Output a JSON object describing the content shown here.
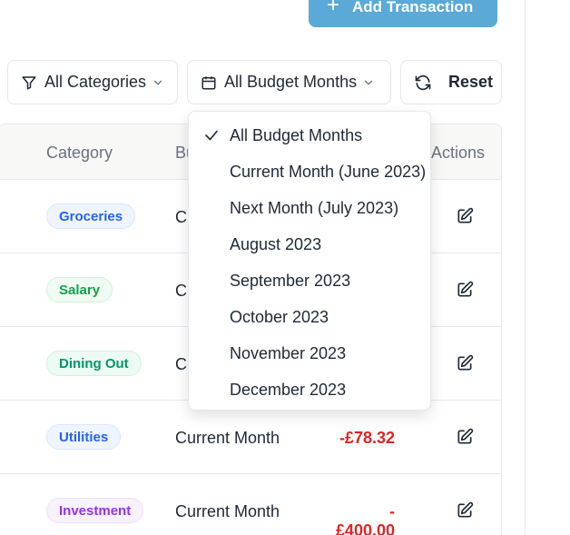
{
  "header": {
    "add_button_label": "Add Transaction",
    "add_icon": "+"
  },
  "filters": {
    "category": {
      "label": "All Categories",
      "icon": "filter-icon"
    },
    "budget_month": {
      "label": "All Budget Months",
      "icon": "calendar-icon"
    },
    "reset": {
      "label": "Reset",
      "icon": "refresh-icon"
    }
  },
  "table": {
    "columns": {
      "category": "Category",
      "budget": "Bu",
      "actions": "Actions"
    },
    "rows": [
      {
        "category": "Groceries",
        "budget": "Cu",
        "amount": ""
      },
      {
        "category": "Salary",
        "budget": "Cu",
        "amount": ""
      },
      {
        "category": "Dining Out",
        "budget": "Cu",
        "amount": ""
      },
      {
        "category": "Utilities",
        "budget": "Current Month",
        "amount": "-£78.32"
      },
      {
        "category": "Investment",
        "budget": "Current Month",
        "amount": "-£400.00"
      }
    ]
  },
  "dropdown": {
    "selected_index": 0,
    "options": [
      "All Budget Months",
      "Current Month (June 2023)",
      "Next Month (July 2023)",
      "August 2023",
      "September 2023",
      "October 2023",
      "November 2023",
      "December 2023"
    ]
  },
  "colors": {
    "accent": "#5aa9d6",
    "negative_amount": "#dc2626",
    "groceries": "#2563eb",
    "salary": "#16a34a",
    "dining_out": "#059669",
    "utilities": "#2563eb",
    "investment": "#9333ea"
  }
}
